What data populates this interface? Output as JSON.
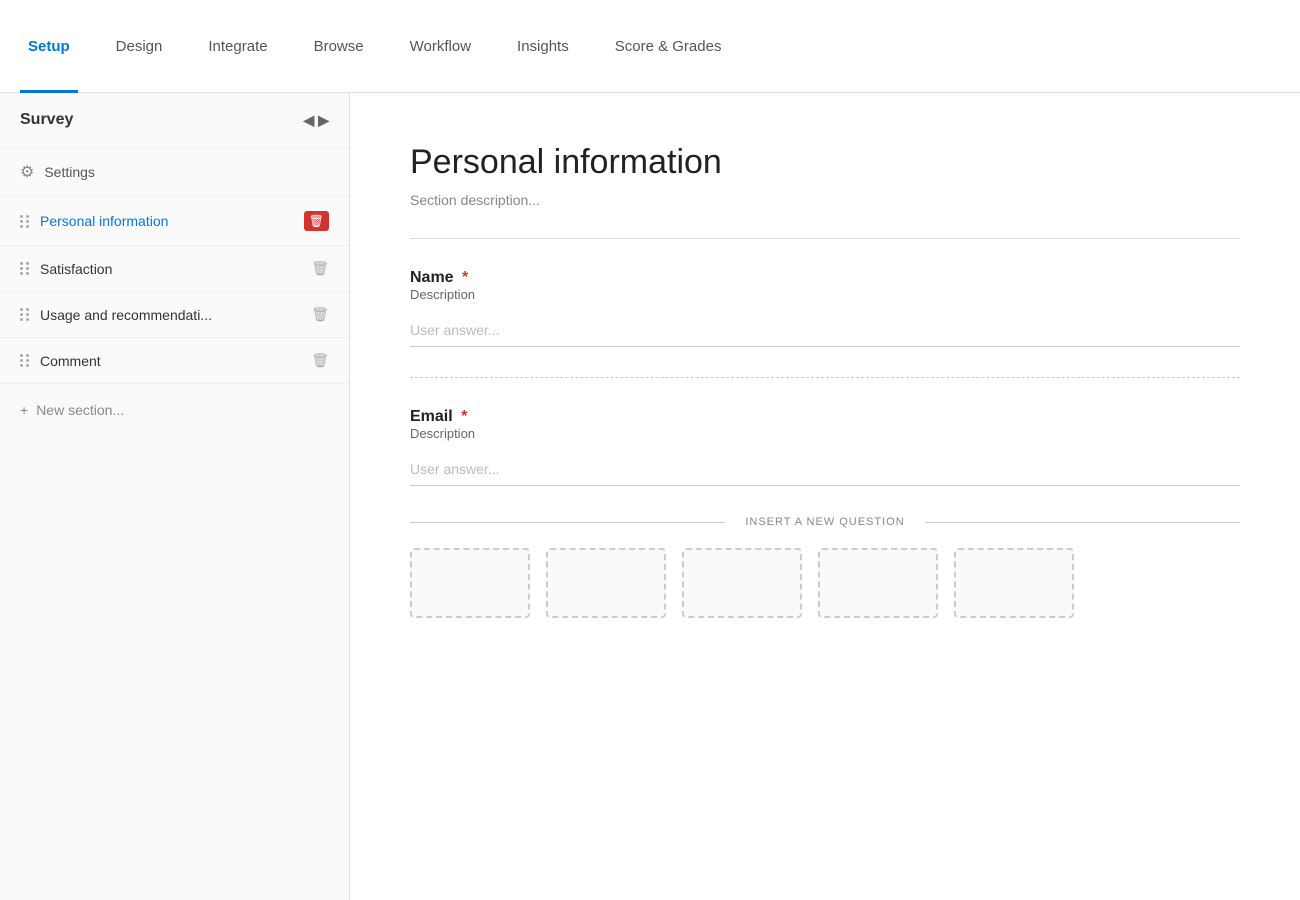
{
  "nav": {
    "items": [
      {
        "id": "setup",
        "label": "Setup",
        "active": true
      },
      {
        "id": "design",
        "label": "Design",
        "active": false
      },
      {
        "id": "integrate",
        "label": "Integrate",
        "active": false
      },
      {
        "id": "browse",
        "label": "Browse",
        "active": false
      },
      {
        "id": "workflow",
        "label": "Workflow",
        "active": false
      },
      {
        "id": "insights",
        "label": "Insights",
        "active": false
      },
      {
        "id": "score-grades",
        "label": "Score & Grades",
        "active": false
      }
    ]
  },
  "sidebar": {
    "header": "Survey",
    "settings_label": "Settings",
    "items": [
      {
        "id": "personal-information",
        "label": "Personal information",
        "active": true
      },
      {
        "id": "satisfaction",
        "label": "Satisfaction",
        "active": false
      },
      {
        "id": "usage-recommendation",
        "label": "Usage and recommendati...",
        "active": false
      },
      {
        "id": "comment",
        "label": "Comment",
        "active": false
      }
    ],
    "new_section_label": "New section..."
  },
  "main": {
    "section_title": "Personal information",
    "section_description": "Section description...",
    "questions": [
      {
        "id": "name",
        "title": "Name",
        "required": true,
        "description": "Description",
        "placeholder": "User answer..."
      },
      {
        "id": "email",
        "title": "Email",
        "required": true,
        "description": "Description",
        "placeholder": "User answer..."
      }
    ],
    "insert_question_label": "INSERT A NEW QUESTION"
  }
}
